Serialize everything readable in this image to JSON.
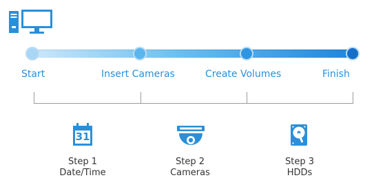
{
  "header": {
    "icon": "computer-icon"
  },
  "progress": {
    "steps": [
      {
        "label": "Start"
      },
      {
        "label": "Insert Cameras"
      },
      {
        "label": "Create Volumes"
      },
      {
        "label": "Finish"
      }
    ],
    "colors": {
      "accent_light": "#cde8fb",
      "accent_mid": "#6cc0f0",
      "accent_dark": "#1f86dc",
      "label": "#2b8fd8"
    }
  },
  "tasks": [
    {
      "title": "Step 1",
      "subtitle": "Date/Time",
      "icon": "calendar-icon",
      "calendar_day": "31"
    },
    {
      "title": "Step 2",
      "subtitle": "Cameras",
      "icon": "dome-camera-icon"
    },
    {
      "title": "Step 3",
      "subtitle": "HDDs",
      "icon": "hard-drive-icon"
    }
  ]
}
